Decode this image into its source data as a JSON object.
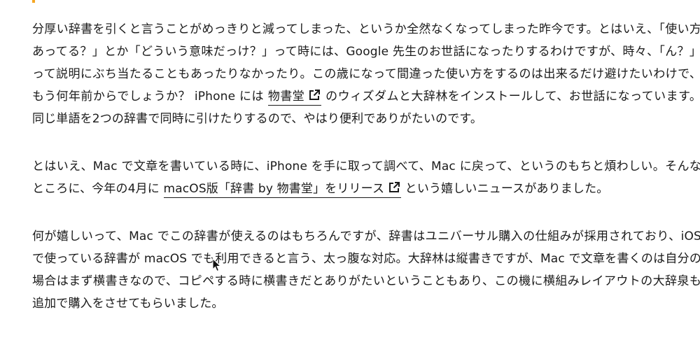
{
  "accent_color": "#f5a623",
  "article": {
    "p1": {
      "before_link": "分厚い辞書を引くと言うことがめっきりと減ってしまった、というか全然なくなってしまった昨今です。とはいえ、「使い方あってる？」とか「どういう意味だっけ？」って時には、Google 先生のお世話になったりするわけですが、時々、「ん？」って説明にぶち当たることもあったりなかったり。この歳になって間違った使い方をするのは出来るだけ避けたいわけで、もう何年前からでしょうか？ iPhone には ",
      "link_text": "物書堂",
      "after_link": " のウィズダムと大辞林をインストールして、お世話になっています。同じ単語を2つの辞書で同時に引けたりするので、やはり便利でありがたいのです。"
    },
    "p2": {
      "before_link": "とはいえ、Mac で文章を書いている時に、iPhone を手に取って調べて、Mac に戻って、というのもちと煩わしい。そんなところに、今年の4月に ",
      "link_text": "macOS版「辞書 by 物書堂」をリリース",
      "after_link": " という嬉しいニュースがありました。"
    },
    "p3": {
      "text": "何が嬉しいって、Mac でこの辞書が使えるのはもちろんですが、辞書はユニバーサル購入の仕組みが採用されており、iOS で使っている辞書が macOS でも利用できると言う、太っ腹な対応。大辞林は縦書きですが、Mac で文章を書くのは自分の場合はまず横書きなので、コピペする時に横書きだとありがたいということもあり、この機に横組みレイアウトの大辞泉も追加で購入をさせてもらいました。"
    }
  },
  "icons": {
    "external_link": "external-link-icon",
    "cursor": "mouse-pointer-icon"
  }
}
